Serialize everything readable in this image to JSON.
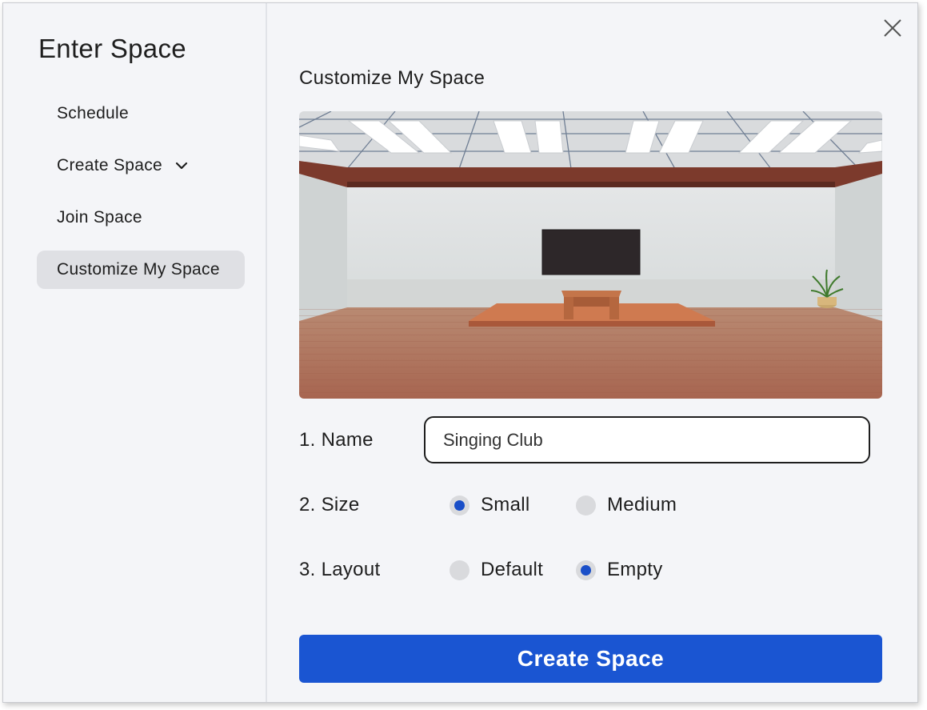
{
  "sidebar": {
    "title": "Enter Space",
    "items": [
      {
        "label": "Schedule",
        "icon": null,
        "active": false
      },
      {
        "label": "Create Space",
        "icon": "chevron-down-icon",
        "active": false
      },
      {
        "label": "Join Space",
        "icon": null,
        "active": false
      },
      {
        "label": "Customize My Space",
        "icon": null,
        "active": true
      }
    ]
  },
  "main": {
    "title": "Customize My Space",
    "close_icon": "close-icon",
    "preview": {
      "image": "3d-room-preview"
    },
    "form": {
      "name_label": "1. Name",
      "name_value": "Singing Club",
      "size_label": "2. Size",
      "size_options": [
        {
          "label": "Small",
          "selected": true
        },
        {
          "label": "Medium",
          "selected": false
        }
      ],
      "layout_label": "3. Layout",
      "layout_options": [
        {
          "label": "Default",
          "selected": false
        },
        {
          "label": "Empty",
          "selected": true
        }
      ]
    },
    "create_button": "Create Space"
  },
  "colors": {
    "accent": "#1a55d2",
    "radio_selected": "#1a4fc8",
    "panel_bg": "#f4f5f8",
    "active_nav_bg": "#dfe0e4"
  }
}
